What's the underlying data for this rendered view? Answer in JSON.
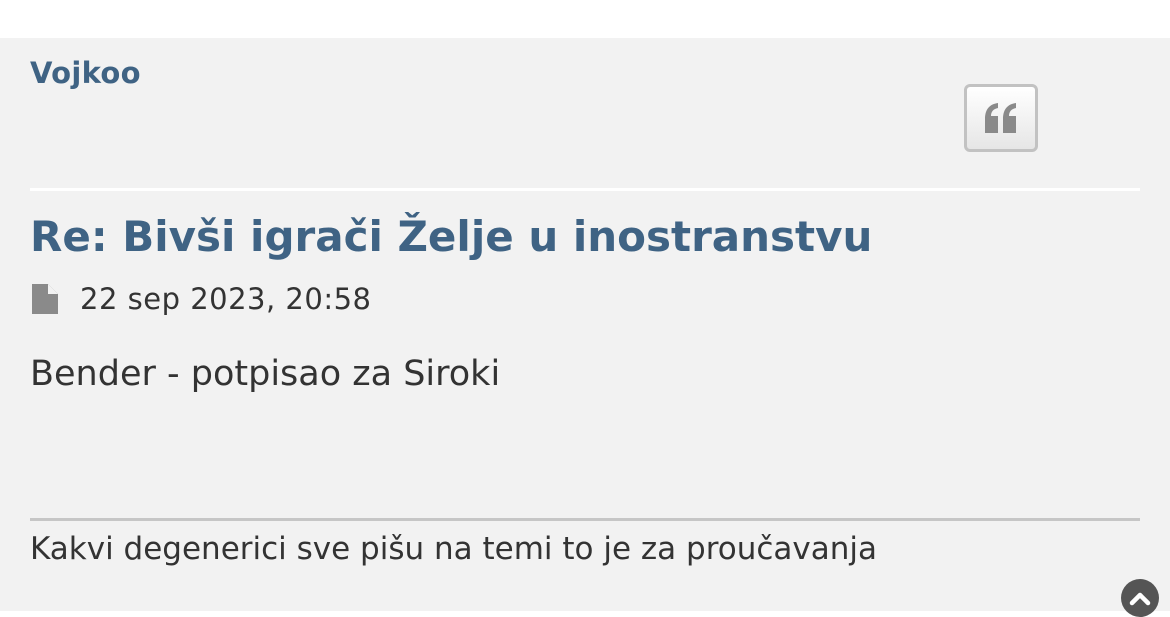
{
  "post": {
    "author": "Vojkoo",
    "title": "Re: Bivši igrači Želje u inostranstvu",
    "date": "22 sep 2023, 20:58",
    "content": "Bender - potpisao za Siroki",
    "signature": "Kakvi degenerici sve pišu na temi to je za proučavanja"
  },
  "icons": {
    "quote": "quote-icon",
    "post_file": "file-icon",
    "back_to_top": "chevron-up-icon"
  },
  "colors": {
    "link": "#3f6384",
    "text": "#333333",
    "post_bg": "#f2f2f2",
    "page_bg": "#ffffff",
    "icon_grey": "#8a8a8a"
  }
}
